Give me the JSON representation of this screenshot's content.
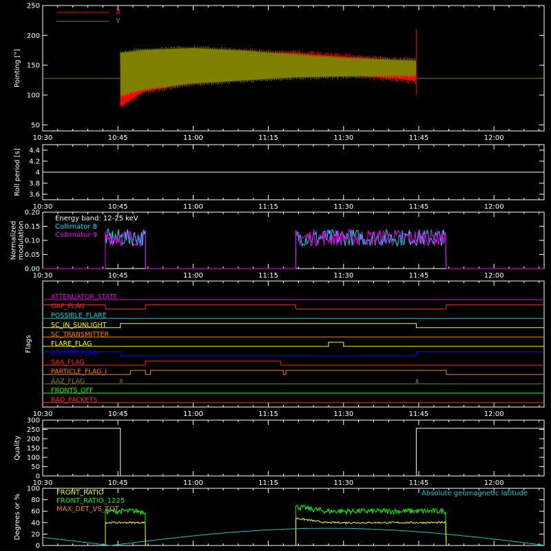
{
  "colors": {
    "background": "#000000",
    "axes": "#ffffff",
    "x_pointing": "#ff0000",
    "y_pointing": "#808000",
    "roll": "#ffffff",
    "collimator8": "#00e5ff",
    "collimator9": "#ff00ff",
    "front_ratio": "#ffff00",
    "front_ratio_1225": "#00ff00",
    "max_det": "#ff8000",
    "abs_geomag_lat": "#00d0d0"
  },
  "time_axis": {
    "start": "10:30",
    "end": "12:10",
    "ticks": [
      "10:30",
      "10:45",
      "11:00",
      "11:15",
      "11:30",
      "11:45",
      "12:00"
    ],
    "tick_minutes": [
      0,
      15,
      30,
      45,
      60,
      75,
      90
    ],
    "range_minutes": [
      0,
      100
    ]
  },
  "chart_data": [
    {
      "type": "line",
      "ylabel": "Pointing [\"]",
      "ylim": [
        40,
        250
      ],
      "yticks": [
        50,
        100,
        150,
        200,
        250
      ],
      "legend": "top-left",
      "series": [
        {
          "name": "X",
          "color": "#ff0000",
          "envelope_minutes": [
            15.5,
            20,
            30,
            40,
            50,
            60,
            70,
            74.5
          ],
          "upper": [
            160,
            165,
            172,
            178,
            176,
            170,
            165,
            163
          ],
          "lower": [
            75,
            100,
            115,
            123,
            128,
            128,
            122,
            118
          ],
          "spike": {
            "minute": 74.5,
            "value": 210
          }
        },
        {
          "name": "Y",
          "color": "#808000",
          "envelope_minutes": [
            15.5,
            20,
            30,
            40,
            50,
            60,
            70,
            74.5
          ],
          "upper": [
            175,
            180,
            183,
            179,
            172,
            166,
            163,
            162
          ],
          "lower": [
            95,
            105,
            115,
            120,
            125,
            127,
            128,
            128
          ],
          "baseline": 128
        }
      ]
    },
    {
      "type": "line",
      "ylabel": "Roll period [s]",
      "ylim": [
        3.5,
        4.5
      ],
      "yticks": [
        3.6,
        3.8,
        4.0,
        4.2,
        4.4
      ],
      "series": [
        {
          "name": "",
          "x_minutes": [
            0,
            100
          ],
          "values": [
            4.0,
            4.0
          ]
        }
      ]
    },
    {
      "type": "line",
      "ylabel": "Normalized modulation",
      "ylim": [
        0,
        0.2
      ],
      "yticks": [
        "0.00",
        "0.05",
        "0.10",
        "0.15",
        "0.20"
      ],
      "legend": "top-left",
      "annotation": "Energy band: 12-25 keV",
      "series": [
        {
          "name": "Collimator 8",
          "color": "#00e5ff",
          "active_intervals_minutes": [
            [
              12.5,
              20.5
            ],
            [
              50.5,
              80.5
            ]
          ],
          "mean": 0.11
        },
        {
          "name": "Collimator 9",
          "color": "#ff00ff",
          "active_intervals_minutes": [
            [
              12.5,
              20.5
            ],
            [
              50.5,
              80.5
            ]
          ],
          "mean": 0.11
        }
      ]
    },
    {
      "type": "line",
      "ylabel": "Flags",
      "flags": [
        {
          "name": "ATTENUATOR_STATE",
          "color": "#e000e0",
          "transitions": []
        },
        {
          "name": "GAP_FLAG",
          "color": "#ff2020",
          "transitions": [
            [
              0,
              1
            ],
            [
              12.5,
              0
            ],
            [
              20.5,
              1
            ],
            [
              50.5,
              0
            ],
            [
              80.5,
              1
            ]
          ]
        },
        {
          "name": "POSSIBLE_FLARE",
          "color": "#00d0d0",
          "transitions": []
        },
        {
          "name": "SC_IN_SUNLIGHT",
          "color": "#ffff00",
          "transitions": [
            [
              0,
              0
            ],
            [
              15.5,
              1
            ],
            [
              74.5,
              0
            ]
          ]
        },
        {
          "name": "SC_TRANSMITTER",
          "color": "#ff8000",
          "transitions": []
        },
        {
          "name": "FLARE_FLAG",
          "color": "#ffff00",
          "transitions": [
            [
              0,
              0
            ],
            [
              57,
              1
            ],
            [
              60,
              0
            ]
          ]
        },
        {
          "name": "ECLIPSE_FLAG",
          "color": "#0000ff",
          "transitions": [
            [
              0,
              1
            ],
            [
              15.5,
              0
            ],
            [
              74.5,
              1
            ]
          ]
        },
        {
          "name": "SAA_FLAG",
          "color": "#ff2020",
          "transitions": [
            [
              0,
              0
            ],
            [
              20.5,
              1
            ],
            [
              47.5,
              0
            ]
          ]
        },
        {
          "name": "PARTICLE_FLAG_I",
          "color": "#ff8000",
          "transitions": [
            [
              0,
              0
            ],
            [
              17.5,
              1
            ],
            [
              20.5,
              0
            ],
            [
              21.5,
              1
            ],
            [
              48,
              0
            ],
            [
              48.5,
              1
            ],
            [
              80.5,
              0
            ]
          ]
        },
        {
          "name": "AAZ_FLAG",
          "color": "#808000",
          "transitions": [
            [
              0,
              0
            ],
            [
              15.5,
              1
            ],
            [
              15.8,
              0
            ],
            [
              74.5,
              1
            ],
            [
              74.8,
              0
            ]
          ]
        },
        {
          "name": "FRONTS_OFF",
          "color": "#00ff00",
          "transitions": []
        },
        {
          "name": "BAD_PACKETS",
          "color": "#ff2020",
          "transitions": []
        }
      ]
    },
    {
      "type": "line",
      "ylabel": "Quality",
      "ylim": [
        0,
        300
      ],
      "yticks": [
        0,
        50,
        100,
        150,
        200,
        250,
        300
      ],
      "series": [
        {
          "name": "",
          "x_minutes": [
            0,
            15.5,
            15.5,
            74.5,
            74.5,
            100
          ],
          "values": [
            256,
            256,
            0,
            0,
            256,
            256
          ]
        }
      ]
    },
    {
      "type": "line",
      "ylabel": "Degrees or %",
      "ylim": [
        0,
        100
      ],
      "yticks": [
        0,
        20,
        40,
        60,
        80,
        100
      ],
      "legend": "top-left",
      "annotation": "Absolute geomagnetic latitude",
      "series": [
        {
          "name": "FRONT_RATIO",
          "color": "#ffff00",
          "segments_minutes": [
            [
              12.5,
              20.5
            ],
            [
              50.5,
              80.5
            ]
          ],
          "level": 40
        },
        {
          "name": "FRONT_RATIO_1225",
          "color": "#00ff00",
          "segments_minutes": [
            [
              12.5,
              20.5
            ],
            [
              50.5,
              80.5
            ]
          ],
          "level": 60
        },
        {
          "name": "MAX_DET_VS_TOT",
          "color": "#ff8000",
          "segments_minutes": [],
          "level": 0
        },
        {
          "name": "Absolute geomagnetic latitude",
          "color": "#00d0d0",
          "zeros_minutes": [
            13.5,
            57
          ],
          "peak": 30
        }
      ]
    }
  ]
}
